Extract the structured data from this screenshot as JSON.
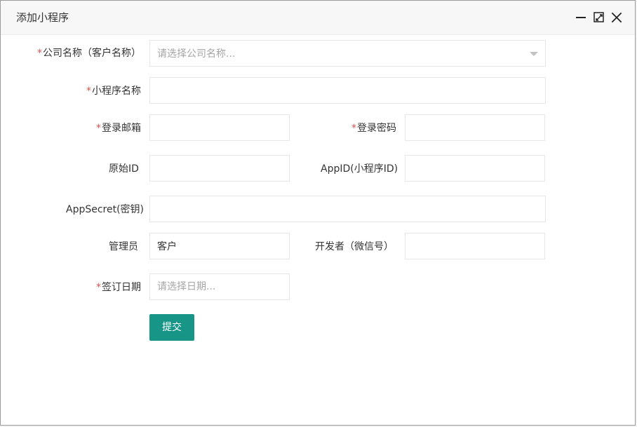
{
  "dialog": {
    "title": "添加小程序",
    "controls": {
      "minimize_icon": "minimize-icon",
      "maximize_icon": "maximize-icon",
      "close_icon": "close-icon"
    }
  },
  "form": {
    "required_marker": "*",
    "company": {
      "label": "公司名称（客户名称）",
      "placeholder": "请选择公司名称...",
      "required": true
    },
    "miniapp_name": {
      "label": "小程序名称",
      "value": "",
      "required": true
    },
    "login_email": {
      "label": "登录邮箱",
      "value": "",
      "required": true
    },
    "login_password": {
      "label": "登录密码",
      "value": "",
      "required": true
    },
    "original_id": {
      "label": "原始ID",
      "value": "",
      "required": false
    },
    "app_id": {
      "label": "AppID(小程序ID)",
      "value": "",
      "required": false
    },
    "app_secret": {
      "label": "AppSecret(密钥)",
      "value": "",
      "required": false
    },
    "admin": {
      "label": "管理员",
      "value": "客户",
      "required": false
    },
    "developer": {
      "label": "开发者（微信号）",
      "value": "",
      "required": false
    },
    "sign_date": {
      "label": "签订日期",
      "placeholder": "请选择日期...",
      "required": true
    },
    "submit": {
      "label": "提交"
    }
  },
  "colors": {
    "required": "#d9534f",
    "submit_button": "#179688",
    "border": "#e6e6e6",
    "placeholder": "#a6a6a6"
  }
}
